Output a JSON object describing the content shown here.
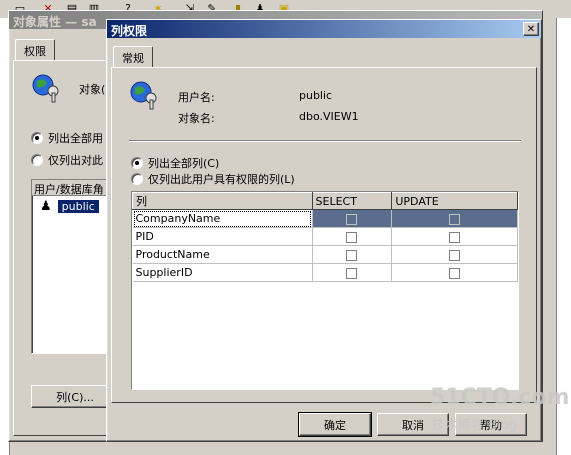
{
  "background_window": {
    "title": "对象属性 — sa",
    "tab_permissions": "权限",
    "object_label": "对象(",
    "radio_list_all": "列出全部用",
    "radio_list_only": "仅列出对此",
    "list_header": "用户/数据库角",
    "list_items": [
      "public"
    ],
    "columns_button": "列(C)..."
  },
  "dialog": {
    "title": "列权限",
    "close_glyph": "✕",
    "tab_general": "常规",
    "user_name_label": "用户名:",
    "user_name_value": "public",
    "object_name_label": "对象名:",
    "object_name_value": "dbo.VIEW1",
    "radio_list_all": "列出全部列(C)",
    "radio_list_permitted": "仅列出此用户具有权限的列(L)",
    "grid_headers": [
      "列",
      "SELECT",
      "UPDATE"
    ],
    "grid_rows": [
      {
        "name": "CompanyName",
        "select": false,
        "update": false,
        "selected": true
      },
      {
        "name": "PID",
        "select": false,
        "update": false,
        "selected": false
      },
      {
        "name": "ProductName",
        "select": false,
        "update": false,
        "selected": false
      },
      {
        "name": "SupplierID",
        "select": false,
        "update": false,
        "selected": false
      }
    ],
    "ok_button": "确定",
    "cancel_button": "取消",
    "help_button": "帮助"
  },
  "watermark": {
    "line1": "51CTO.com",
    "line2": "技术博客  Blog"
  },
  "icons": [
    "new-icon",
    "delete-icon",
    "properties-icon",
    "export-icon",
    "help-icon",
    "wizard-icon",
    "run-icon",
    "key-icon"
  ]
}
